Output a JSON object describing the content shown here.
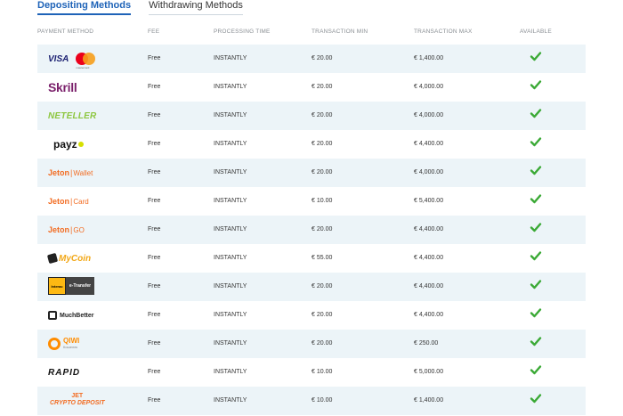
{
  "tabs": {
    "depositing": "Depositing Methods",
    "withdrawing": "Withdrawing Methods"
  },
  "headers": {
    "method": "PAYMENT METHOD",
    "fee": "FEE",
    "processing": "PROCESSING TIME",
    "min": "TRANSACTION MIN",
    "max": "TRANSACTION MAX",
    "available": "AVAILABLE"
  },
  "methods": [
    {
      "logo": "VISA",
      "logo_sub": "mastercard",
      "fee": "Free",
      "processing": "INSTANTLY",
      "min": "€ 20.00",
      "max": "€ 1,400.00"
    },
    {
      "logo": "Skrill",
      "fee": "Free",
      "processing": "INSTANTLY",
      "min": "€ 20.00",
      "max": "€ 4,000.00"
    },
    {
      "logo": "NETELLER",
      "fee": "Free",
      "processing": "INSTANTLY",
      "min": "€ 20.00",
      "max": "€ 4,000.00"
    },
    {
      "logo": "payz",
      "fee": "Free",
      "processing": "INSTANTLY",
      "min": "€ 20.00",
      "max": "€ 4,400.00"
    },
    {
      "logo": "Jeton",
      "logo_sub": "Wallet",
      "fee": "Free",
      "processing": "INSTANTLY",
      "min": "€ 20.00",
      "max": "€ 4,000.00"
    },
    {
      "logo": "Jeton",
      "logo_sub": "Card",
      "fee": "Free",
      "processing": "INSTANTLY",
      "min": "€ 10.00",
      "max": "€ 5,400.00"
    },
    {
      "logo": "Jeton",
      "logo_sub": "GO",
      "fee": "Free",
      "processing": "INSTANTLY",
      "min": "€ 20.00",
      "max": "€ 4,400.00"
    },
    {
      "logo": "MyCoin",
      "fee": "Free",
      "processing": "INSTANTLY",
      "min": "€ 55.00",
      "max": "€ 4,400.00"
    },
    {
      "logo": "Interac",
      "logo_sub": "e-Transfer",
      "fee": "Free",
      "processing": "INSTANTLY",
      "min": "€ 20.00",
      "max": "€ 4,400.00"
    },
    {
      "logo": "MuchBetter",
      "fee": "Free",
      "processing": "INSTANTLY",
      "min": "€ 20.00",
      "max": "€ 4,400.00"
    },
    {
      "logo": "QIWI",
      "logo_sub": "Кошелек",
      "fee": "Free",
      "processing": "INSTANTLY",
      "min": "€ 20.00",
      "max": "€ 250.00"
    },
    {
      "logo": "RAPID",
      "fee": "Free",
      "processing": "INSTANTLY",
      "min": "€ 10.00",
      "max": "€ 5,000.00"
    },
    {
      "logo": "JET",
      "logo_sub": "CRYPTO DEPOSIT",
      "fee": "Free",
      "processing": "INSTANTLY",
      "min": "€ 10.00",
      "max": "€ 1,400.00"
    }
  ],
  "colors": {
    "accent": "#1e63b8",
    "row_alt": "#ecf4f8",
    "check": "#3aa935",
    "jeton": "#f26c22"
  },
  "icons": {
    "available": "check-icon"
  }
}
